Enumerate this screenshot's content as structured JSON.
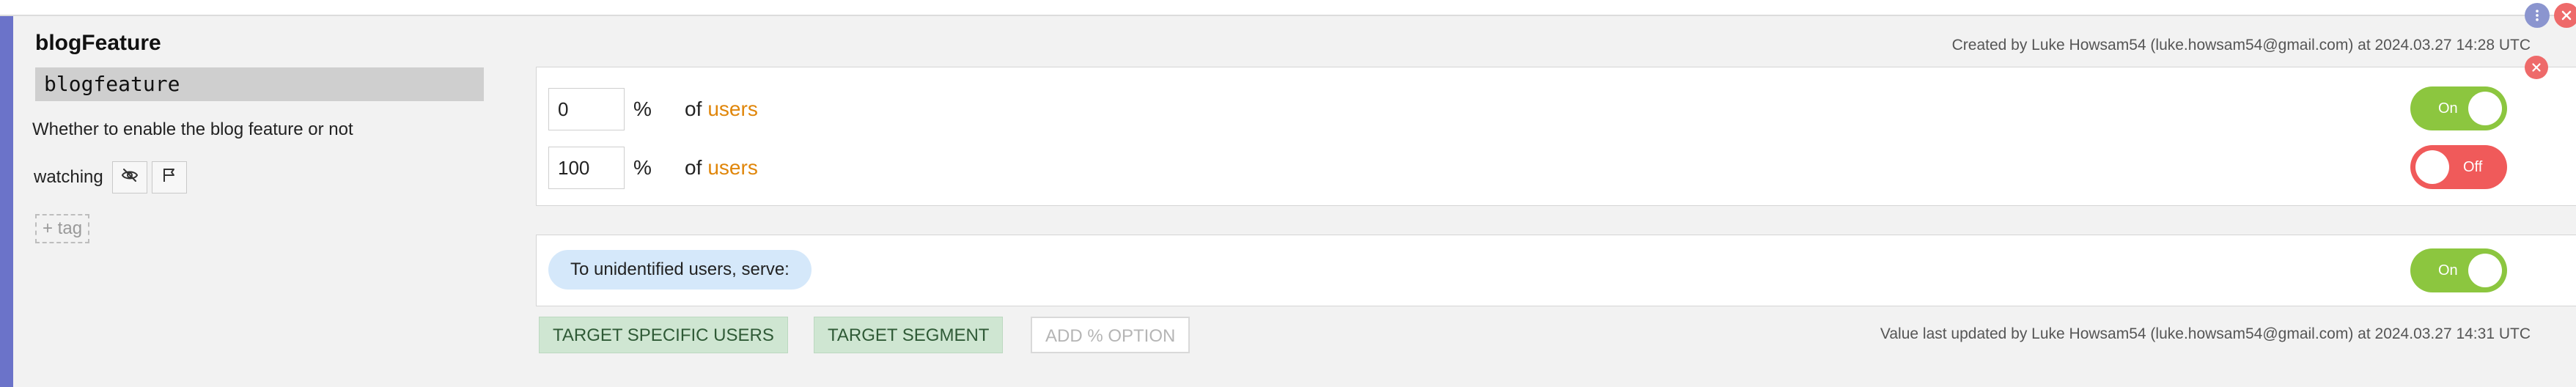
{
  "colors": {
    "accent_bar": "#6b73c9",
    "toggle_on": "#8cc63f",
    "toggle_off": "#f05a5a",
    "users_link": "#e0860a",
    "close": "#ee6a6a"
  },
  "window": {
    "more_icon": "vertical-dots-icon",
    "close_icon": "close-icon"
  },
  "flag": {
    "name": "blogFeature",
    "key": "blogfeature",
    "description": "Whether to enable the blog feature or not",
    "watching_label": "watching",
    "unwatch_icon": "eye-off-icon",
    "flag_icon": "flag-icon",
    "tag_button": "+ tag"
  },
  "meta": {
    "created": "Created by Luke Howsam54 (luke.howsam54@gmail.com) at 2024.03.27 14:28 UTC",
    "updated": "Value last updated by Luke Howsam54 (luke.howsam54@gmail.com) at 2024.03.27 14:31 UTC"
  },
  "rules": {
    "close_icon": "close-icon",
    "items": [
      {
        "percent": "0",
        "percent_sign": "%",
        "of": "of",
        "users": "users",
        "toggle": "On",
        "state": "on"
      },
      {
        "percent": "100",
        "percent_sign": "%",
        "of": "of",
        "users": "users",
        "toggle": "Off",
        "state": "off"
      }
    ]
  },
  "serve": {
    "label": "To unidentified users, serve:",
    "toggle": "On",
    "state": "on"
  },
  "actions": {
    "target_specific_users": "TARGET SPECIFIC USERS",
    "target_segment": "TARGET SEGMENT",
    "add_percent_option": "ADD % OPTION"
  }
}
